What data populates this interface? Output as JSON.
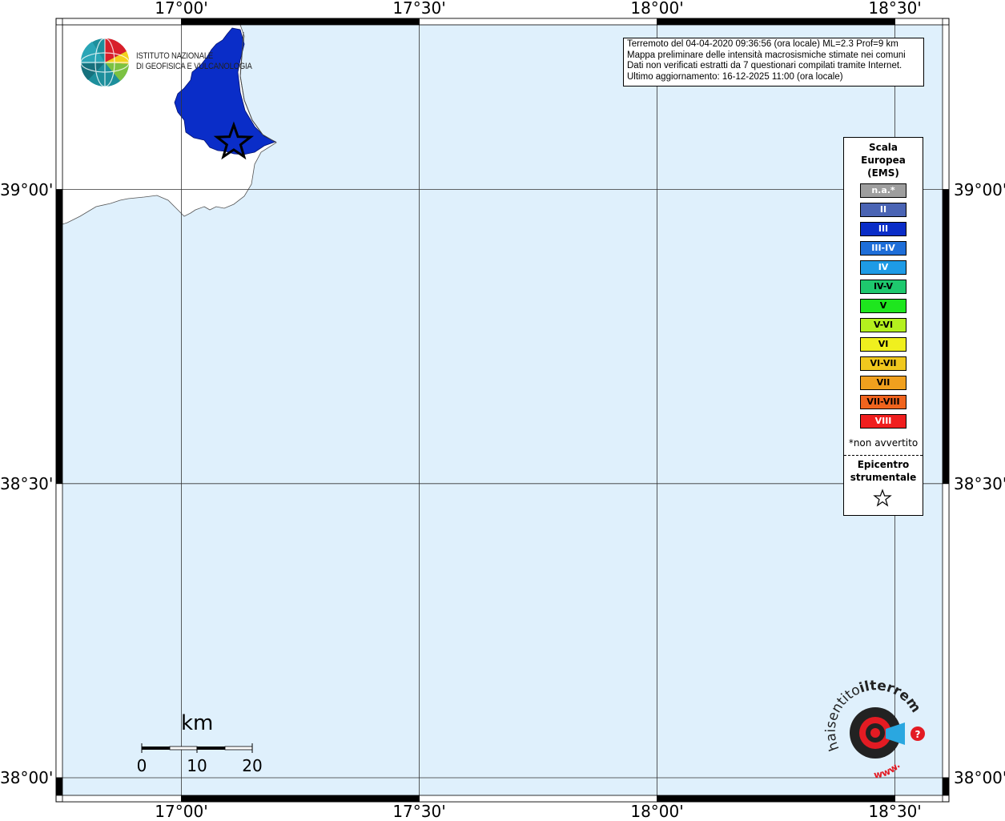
{
  "map": {
    "lon_min": 16.75,
    "lon_max": 18.6,
    "lat_min": 37.97,
    "lat_max": 39.28,
    "colors": {
      "sea": "#dff0fc",
      "land": "#ffffff",
      "felt_area": "#0a2dc8",
      "frame_dark": "#000000",
      "frame_light": "#ffffff",
      "grid": "#333333"
    }
  },
  "axes": {
    "top_labels": [
      "17°00'",
      "17°30'",
      "18°00'",
      "18°30'"
    ],
    "bottom_labels": [
      "17°00'",
      "17°30'",
      "18°00'",
      "18°30'"
    ],
    "left_labels": [
      "39°00'",
      "38°30'",
      "38°00'"
    ],
    "right_labels": [
      "39°00'",
      "38°30'",
      "38°00'"
    ]
  },
  "logo": {
    "line1": "ISTITUTO NAZIONALE",
    "line2": "DI GEOFISICA E VULCANOLOGIA",
    "icon": "globe-logo-icon"
  },
  "info": {
    "line1": "Terremoto del 04-04-2020 09:36:56 (ora locale) ML=2.3 Prof=9 km",
    "line2": "Mappa preliminare delle intensità macrosismiche stimate nei comuni",
    "line3": "Dati non verificati estratti da 7 questionari compilati tramite Internet.",
    "line4": "Ultimo aggiornamento: 16-12-2025 11:00 (ora locale)"
  },
  "epicenter": {
    "lon": 17.11,
    "lat": 39.08,
    "icon": "star-icon"
  },
  "legend": {
    "title1": "Scala",
    "title2": "Europea",
    "title3": "(EMS)",
    "items": [
      {
        "label": "n.a.*",
        "color": "#9e9e9e",
        "text_color": "#ffffff"
      },
      {
        "label": "II",
        "color": "#4a64b4",
        "text_color": "#ffffff"
      },
      {
        "label": "III",
        "color": "#0a2dc8",
        "text_color": "#ffffff"
      },
      {
        "label": "III-IV",
        "color": "#1e6ed8",
        "text_color": "#ffffff"
      },
      {
        "label": "IV",
        "color": "#1e9be6",
        "text_color": "#ffffff"
      },
      {
        "label": "IV-V",
        "color": "#1ec86e",
        "text_color": "#000000"
      },
      {
        "label": "V",
        "color": "#1ee61e",
        "text_color": "#000000"
      },
      {
        "label": "V-VI",
        "color": "#b4f01e",
        "text_color": "#000000"
      },
      {
        "label": "VI",
        "color": "#f0f01e",
        "text_color": "#000000"
      },
      {
        "label": "VI-VII",
        "color": "#f0c81e",
        "text_color": "#000000"
      },
      {
        "label": "VII",
        "color": "#f0a01e",
        "text_color": "#000000"
      },
      {
        "label": "VII-VIII",
        "color": "#f0641e",
        "text_color": "#000000"
      },
      {
        "label": "VIII",
        "color": "#f01e1e",
        "text_color": "#ffffff"
      }
    ],
    "note": "*non avvertito",
    "epicenter_label1": "Epicentro",
    "epicenter_label2": "strumentale",
    "epicenter_icon": "star-icon"
  },
  "scalebar": {
    "unit": "km",
    "ticks": [
      "0",
      "10",
      "20"
    ]
  },
  "watermark": {
    "text1": "haisentito",
    "text2": "ilterremoto.it",
    "text3": "www.",
    "icon": "haisentito-logo-icon"
  }
}
